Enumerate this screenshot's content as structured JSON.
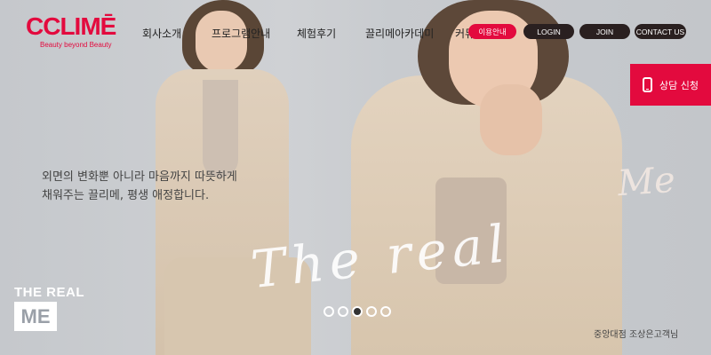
{
  "brand": {
    "logo": "CCLIMĒ",
    "slogan": "Beauty beyond Beauty",
    "accent": "#e30a3e"
  },
  "nav": {
    "items": [
      "회사소개",
      "프로그램안내",
      "체험후기",
      "끌리메아카데미",
      "커뮤니티"
    ]
  },
  "top_buttons": {
    "info": "이용안내",
    "login": "LOGIN",
    "join": "JOIN",
    "contact": "CONTACT US"
  },
  "consult": {
    "label": "상담 신청",
    "icon": "phone-icon"
  },
  "hero": {
    "tagline_line1": "외면의 변화뿐 아니라 마음까지 따뜻하게",
    "tagline_line2": "채워주는 끌리메, 평생 애정합니다.",
    "script_real": "The real",
    "script_me": "Me",
    "badge_line1": "THE REAL",
    "badge_line2": "ME",
    "caption": "중앙대점 조상은고객님"
  },
  "slider": {
    "count": 5,
    "active_index": 2
  }
}
